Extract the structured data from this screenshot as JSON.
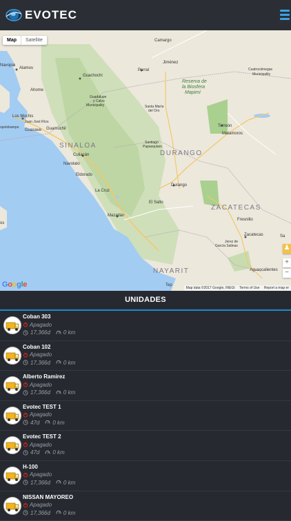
{
  "header": {
    "brand": "EVOTEC",
    "menu_icon": "hamburger-menu-icon",
    "accent_color": "#3aa3e8"
  },
  "map": {
    "map_button": "Map",
    "satellite_button": "Satellite",
    "google_logo": "Google",
    "attribution": "Map data ©2017 Google, INEGI",
    "terms": "Terms of Use",
    "report": "Report a map er",
    "labels": {
      "navojoa": "Navojoa",
      "alamos": "Alamos",
      "guachochi": "Guachochi",
      "camargo": "Camargo",
      "jimenez": "Jiménez",
      "parral": "Parral",
      "reserva": "Reserva de",
      "biosfera": "la Biosfera",
      "mapimi": "Mapimí",
      "cuatrocienegas": "Cuatrociénegas",
      "cuatro_muni": "Municipality",
      "ahome": "Ahome",
      "guadalupe": "Guadalupe",
      "y_calvo": "y Calvo",
      "calvo_muni": "Municipality",
      "santa_maria": "Santa María",
      "del_oro": "del Oro",
      "torreon": "Torreón",
      "matamoros": "Matamoros",
      "los_mochis": "Los Mochis",
      "juan_jose_rios": "Juan José Ríos",
      "topolobampo": "opolobampo",
      "guasave": "Guasave",
      "guamuchil": "Guamúchil",
      "sinaloa": "SINALOA",
      "durango_state": "DURANGO",
      "santiago": "Santiago",
      "papasquiaro": "Papasquiaro",
      "culiacan": "Culiacán",
      "navolato": "Navolato",
      "eldorado": "Eldorado",
      "la_cruz": "La Cruz",
      "durango_city": "Durango",
      "el_salto": "El Salto",
      "zacatecas_state": "ZACATECAS",
      "fresnillo": "Fresnillo",
      "mazatlan": "Mazatlán",
      "zacatecas_city": "Zacatecas",
      "jerez": "Jerez de",
      "garcia_salinas": "García Salinas",
      "sa": "Sa",
      "nayarit": "NAYARIT",
      "aguascalientes": "Aguascalientes",
      "tepic": "Tep",
      "os": "os"
    },
    "route_shields": [
      "45",
      "24",
      "49",
      "40",
      "40",
      "40",
      "15",
      "45",
      "49",
      "45",
      "15D",
      "40D",
      "40"
    ]
  },
  "section": {
    "title": "UNIDADES",
    "accent_color": "#1f8ad1"
  },
  "units": [
    {
      "name": "Coban 303",
      "status": "Apagado",
      "time": "17,366d",
      "distance": "0 km"
    },
    {
      "name": "Coban 102",
      "status": "Apagado",
      "time": "17,366d",
      "distance": "0 km"
    },
    {
      "name": "Alberto Ramirez",
      "status": "Apagado",
      "time": "17,366d",
      "distance": "0 km"
    },
    {
      "name": "Evotec TEST 1",
      "status": "Apagado",
      "time": "47d",
      "distance": "0 km"
    },
    {
      "name": "Evotec TEST 2",
      "status": "Apagado",
      "time": "47d",
      "distance": "0 km"
    },
    {
      "name": "H-100",
      "status": "Apagado",
      "time": "17,366d",
      "distance": "0 km"
    },
    {
      "name": "NISSAN MAYOREO",
      "status": "Apagado",
      "time": "17,366d",
      "distance": "0 km"
    }
  ],
  "colors": {
    "status_off": "#d9231d",
    "meta_text": "#9a9fa6"
  }
}
